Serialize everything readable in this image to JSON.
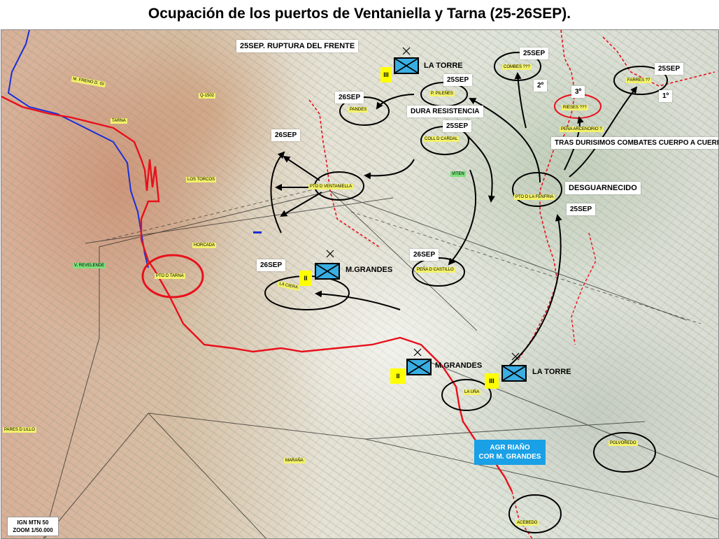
{
  "title": "Ocupación de los puertos de Ventaniella y Tarna (25-26SEP).",
  "phase_labels": {
    "rupture": "25SEP. RUPTURA DEL FRENTE",
    "dura": "DURA RESISTENCIA",
    "tras": "TRAS DURISIMOS COMBATES CUERPO A CUERPO",
    "desguarnecido": "DESGUARNECIDO"
  },
  "date_labels": {
    "d_combes": "25SEP",
    "d_farres": "25SEP",
    "d_pilenes": "25SEP",
    "d_pandes": "26SEP",
    "d_cardal": "25SEP",
    "d_vent": "26SEP",
    "d_fenfria": "25SEP",
    "d_castillo": "26SEP",
    "d_llaciera": "26SEP"
  },
  "order_labels": {
    "o2": "2º",
    "o3": "3º",
    "o1": "1º"
  },
  "places": {
    "freno": "M. FRENO D. GI",
    "tarna_v": "TARNA",
    "q1502": "Q-1502",
    "torcos": "LOS TORCOS",
    "horcada": "HORCADA",
    "revelende": "V. REVELENDE",
    "pto_tarna": "PTO D TARNA",
    "pares": "PARES D LILLO",
    "marana": "MARAÑA",
    "combes": "COMBES ???",
    "farres": "FARRES ??",
    "pilenes": "P. PILEÑES",
    "pandes": "PANDES",
    "rieses": "RIESES ???",
    "arcenorio": "PEÑA ARCENORIO ?",
    "cardal": "COLL D CARDAL",
    "viten": "VITEN",
    "pto_vent": "PTO D VENTANIELLA",
    "pto_fenfria": "PTO D LA FENFRIA",
    "castillo": "PEÑA D CASTILLO",
    "llaciera": "LA CIERA",
    "uña": "LA UÑA",
    "polvoredo": "POLVOREDO",
    "acebedo": "ACEBEDO"
  },
  "units": {
    "torre_top": {
      "echelon": "III",
      "name": "LA TORRE"
    },
    "grandes_mid": {
      "echelon": "II",
      "name": "M.GRANDES"
    },
    "grandes_low": {
      "echelon": "II",
      "name": "M.GRANDES"
    },
    "torre_low": {
      "echelon": "III",
      "name": "LA TORRE"
    }
  },
  "agrupacion": {
    "line1": "AGR RIAÑO",
    "line2": "COR M. GRANDES",
    "color": "#1aa0e6"
  },
  "scale": {
    "line1": "IGN MTN 50",
    "line2": "ZOOM 1/50.000"
  },
  "colors": {
    "front_line": "#e8101c",
    "river": "#1a2fd8",
    "arrow": "#000000",
    "unit_fill": "#39aee3",
    "echelon_fill": "#ffff00"
  }
}
